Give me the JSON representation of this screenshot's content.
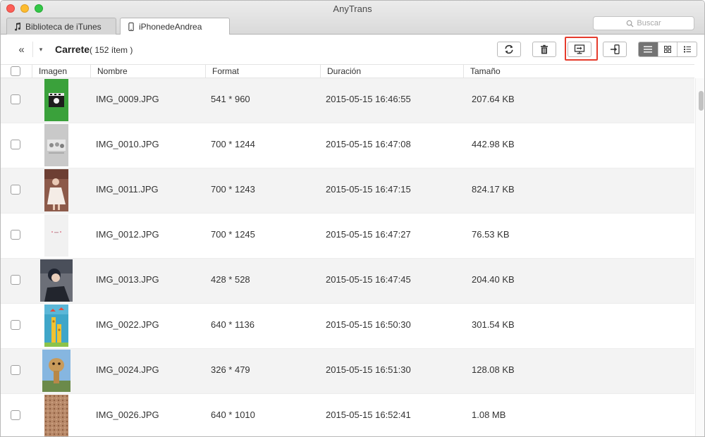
{
  "app": {
    "title": "AnyTrans",
    "search_placeholder": "Buscar"
  },
  "tabs": [
    {
      "label": "Biblioteca de iTunes",
      "icon": "music-note-icon"
    },
    {
      "label": "iPhonedeAndrea",
      "icon": "phone-icon",
      "active": true
    }
  ],
  "toolbar": {
    "title": "Carrete",
    "count_text": "( 152 ítem )",
    "buttons": [
      "refresh-icon",
      "trash-icon",
      "export-to-computer-icon",
      "import-to-device-icon"
    ],
    "views": [
      "list-view-icon",
      "grid-view-icon",
      "detail-view-icon"
    ],
    "active_view": "list",
    "highlight_color": "#e53b2c"
  },
  "columns": [
    "Imagen",
    "Nombre",
    "Format",
    "Duración",
    "Tamaño"
  ],
  "rows": [
    {
      "name": "IMG_0009.JPG",
      "format": "541 * 960",
      "date": "2015-05-15 16:46:55",
      "size": "207.64 KB"
    },
    {
      "name": "IMG_0010.JPG",
      "format": "700 * 1244",
      "date": "2015-05-15 16:47:08",
      "size": "442.98 KB"
    },
    {
      "name": "IMG_0011.JPG",
      "format": "700 * 1243",
      "date": "2015-05-15 16:47:15",
      "size": "824.17 KB"
    },
    {
      "name": "IMG_0012.JPG",
      "format": "700 * 1245",
      "date": "2015-05-15 16:47:27",
      "size": "76.53 KB"
    },
    {
      "name": "IMG_0013.JPG",
      "format": "428 * 528",
      "date": "2015-05-15 16:47:45",
      "size": "204.40 KB"
    },
    {
      "name": "IMG_0022.JPG",
      "format": "640 * 1136",
      "date": "2015-05-15 16:50:30",
      "size": "301.54 KB"
    },
    {
      "name": "IMG_0024.JPG",
      "format": "326 * 479",
      "date": "2015-05-15 16:51:30",
      "size": "128.08 KB"
    },
    {
      "name": "IMG_0026.JPG",
      "format": "640 * 1010",
      "date": "2015-05-15 16:52:41",
      "size": "1.08 MB"
    }
  ]
}
